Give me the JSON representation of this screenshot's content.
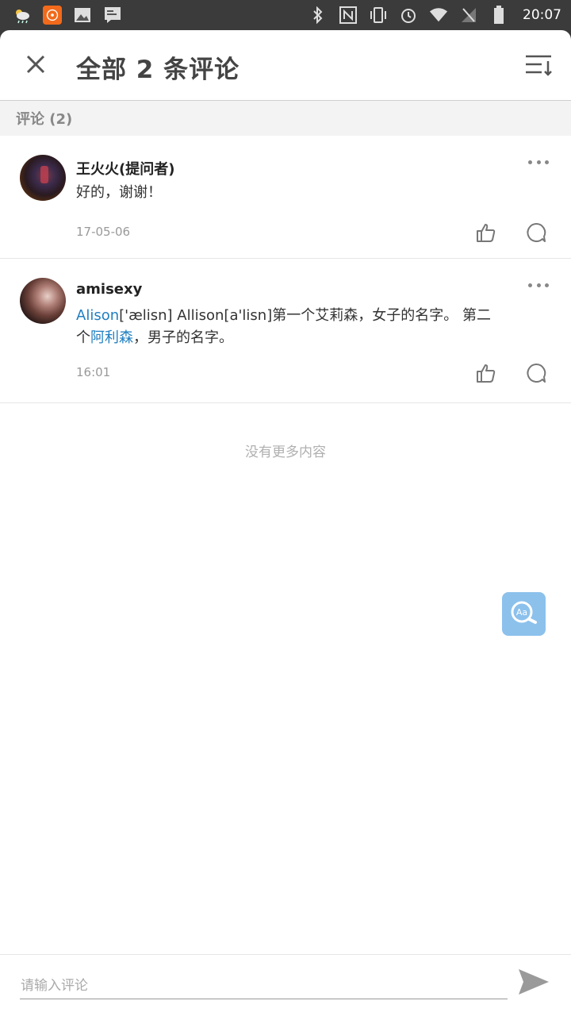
{
  "status_bar": {
    "time": "20:07",
    "left_icons": [
      "weather-icon",
      "app-notification-icon",
      "image-icon",
      "message-icon"
    ],
    "right_icons": [
      "bluetooth-icon",
      "nfc-icon",
      "vibrate-icon",
      "alarm-icon",
      "wifi-icon",
      "signal-icon",
      "battery-icon"
    ]
  },
  "header": {
    "title": "全部 2 条评论",
    "close_icon": "close-icon",
    "sort_icon": "sort-icon"
  },
  "section": {
    "label": "评论 (2)"
  },
  "comments": [
    {
      "author": "王火火(提问者)",
      "text": "好的，谢谢！",
      "time": "17-05-06"
    },
    {
      "author": "amisexy",
      "text_parts": {
        "link1": "Alison",
        "part1": "['ælisn] Allison[a'lisn]第一个艾莉森，女子的名字。 第二个",
        "link2": "阿利森",
        "part2": "，男子的名字。"
      },
      "time": "16:01"
    }
  ],
  "no_more_text": "没有更多内容",
  "float_button_label": "Aa",
  "footer": {
    "input_placeholder": "请输入评论",
    "input_value": ""
  },
  "colors": {
    "link": "#1f7fc1",
    "float_button": "#8cc1ec",
    "status_bar": "#3b3b3b"
  }
}
